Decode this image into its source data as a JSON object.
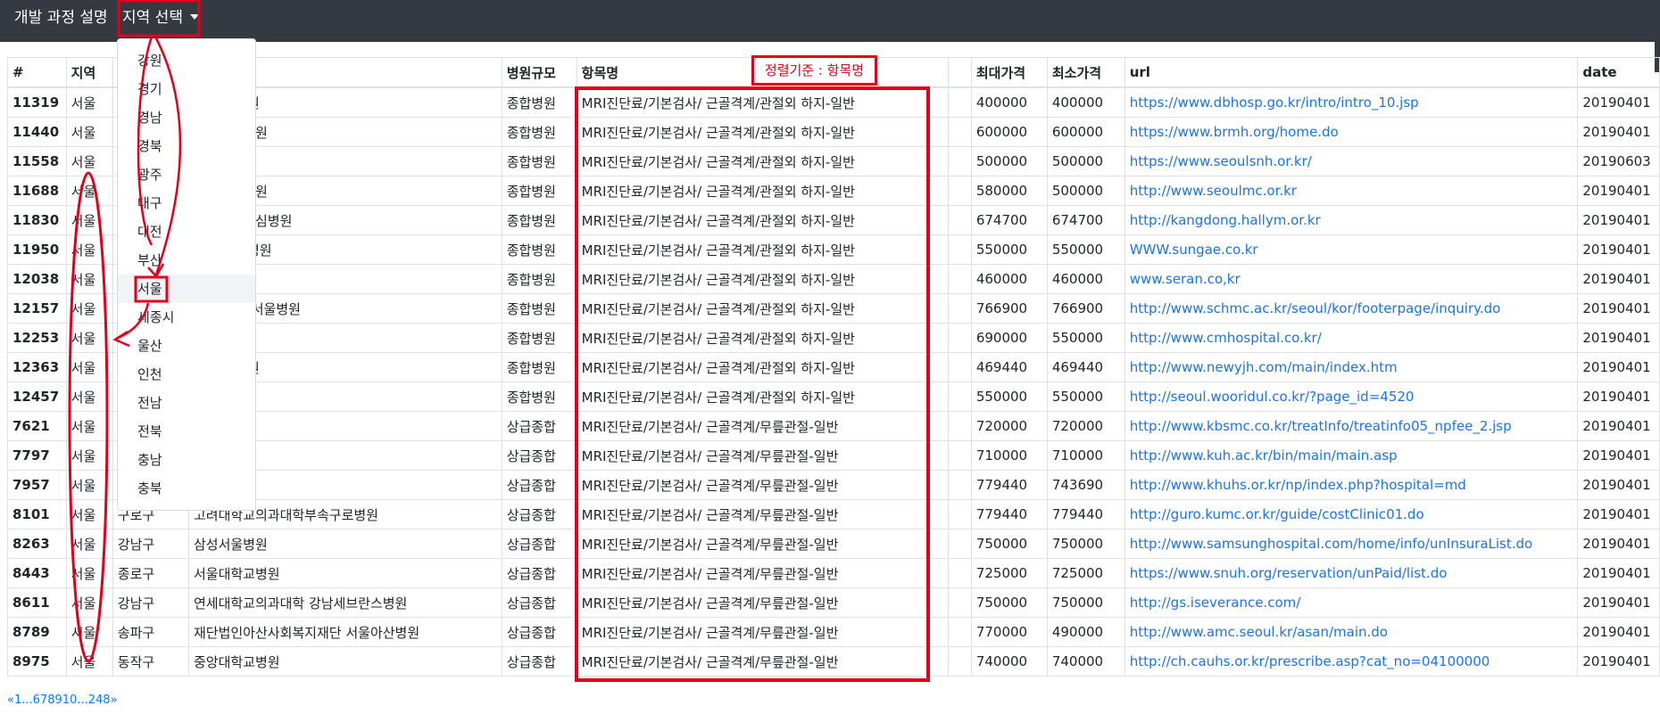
{
  "navbar": {
    "about_label": "개발 과정 설명",
    "region_label": "지역 선택"
  },
  "region_menu": {
    "items": [
      "강원",
      "경기",
      "경남",
      "경북",
      "광주",
      "대구",
      "대전",
      "부산",
      "서울",
      "세종시",
      "울산",
      "인천",
      "전남",
      "전북",
      "충남",
      "충북"
    ],
    "selected": "서울"
  },
  "sort_annotation": "정렬기준 : 항목명",
  "table": {
    "columns": [
      "#",
      "지역",
      "",
      "",
      "병원규모",
      "항목명",
      "",
      "최대가격",
      "최소가격",
      "url",
      "date"
    ],
    "rows": [
      [
        "11319",
        "서울",
        "",
        "시 동부병원",
        "종합병원",
        "MRI진단료/기본검사/ 근골격계/관절외 하지-일반",
        "400000",
        "400000",
        "https://www.dbhosp.go.kr/intro/intro_10.jsp",
        "20190401"
      ],
      [
        "11440",
        "서울",
        "",
        "시보라매병원",
        "종합병원",
        "MRI진단료/기본검사/ 근골격계/관절외 하지-일반",
        "600000",
        "600000",
        "https://www.brmh.org/home.do",
        "20190401"
      ],
      [
        "11558",
        "서울",
        "",
        "시서남병원",
        "종합병원",
        "MRI진단료/기본검사/ 근골격계/관절외 하지-일반",
        "500000",
        "500000",
        "https://www.seoulsnh.or.kr/",
        "20190603"
      ],
      [
        "11688",
        "서울",
        "",
        "시서울의료원",
        "종합병원",
        "MRI진단료/기본검사/ 근골격계/관절외 하지-일반",
        "580000",
        "500000",
        "http://www.seoulmc.or.kr",
        "20190401"
      ],
      [
        "11830",
        "서울",
        "",
        "재단강동성심병원",
        "종합병원",
        "MRI진단료/기본검사/ 근골격계/관절외 하지-일반",
        "674700",
        "674700",
        "http://kangdong.hallym.or.kr",
        "20190401"
      ],
      [
        "11950",
        "서울",
        "",
        "재단 성애병원",
        "종합병원",
        "MRI진단료/기본검사/ 근골격계/관절외 하지-일반",
        "550000",
        "550000",
        "WWW.sungae.co.kr",
        "20190401"
      ],
      [
        "12038",
        "서울",
        "",
        "",
        "종합병원",
        "MRI진단료/기본검사/ 근골격계/관절외 하지-일반",
        "460000",
        "460000",
        "www.seran.co,kr",
        "20190401"
      ],
      [
        "12157",
        "서울",
        "",
        "학교 부속 서울병원",
        "종합병원",
        "MRI진단료/기본검사/ 근골격계/관절외 하지-일반",
        "766900",
        "766900",
        "http://www.schmc.ac.kr/seoul/kor/footerpage/inquiry.do",
        "20190401"
      ],
      [
        "12253",
        "서울",
        "",
        "",
        "종합병원",
        "MRI진단료/기본검사/ 근골격계/관절외 하지-일반",
        "690000",
        "550000",
        "http://www.cmhospital.co.kr/",
        "20190401"
      ],
      [
        "12363",
        "서울",
        "",
        "스 양지병원",
        "종합병원",
        "MRI진단료/기본검사/ 근골격계/관절외 하지-일반",
        "469440",
        "469440",
        "http://www.newyjh.com/main/index.htm",
        "20190401"
      ],
      [
        "12457",
        "서울",
        "",
        "원",
        "종합병원",
        "MRI진단료/기본검사/ 근골격계/관절외 하지-일반",
        "550000",
        "550000",
        "http://seoul.wooridul.co.kr/?page_id=4520",
        "20190401"
      ],
      [
        "7621",
        "서울",
        "",
        "병원",
        "상급종합",
        "MRI진단료/기본검사/ 근골격계/무릎관절-일반",
        "720000",
        "720000",
        "http://www.kbsmc.co.kr/treatInfo/treatinfo05_npfee_2.jsp",
        "20190401"
      ],
      [
        "7797",
        "서울",
        "",
        "교병원",
        "상급종합",
        "MRI진단료/기본검사/ 근골격계/무릎관절-일반",
        "710000",
        "710000",
        "http://www.kuh.ac.kr/bin/main/main.asp",
        "20190401"
      ],
      [
        "7957",
        "서울",
        "",
        "교병원",
        "상급종합",
        "MRI진단료/기본검사/ 근골격계/무릎관절-일반",
        "779440",
        "743690",
        "http://www.khuhs.or.kr/np/index.php?hospital=md",
        "20190401"
      ],
      [
        "8101",
        "서울",
        "구로구",
        "고려대학교의과대학부속구로병원",
        "상급종합",
        "MRI진단료/기본검사/ 근골격계/무릎관절-일반",
        "779440",
        "779440",
        "http://guro.kumc.or.kr/guide/costClinic01.do",
        "20190401"
      ],
      [
        "8263",
        "서울",
        "강남구",
        "삼성서울병원",
        "상급종합",
        "MRI진단료/기본검사/ 근골격계/무릎관절-일반",
        "750000",
        "750000",
        "http://www.samsunghospital.com/home/info/unInsuraList.do",
        "20190401"
      ],
      [
        "8443",
        "서울",
        "종로구",
        "서울대학교병원",
        "상급종합",
        "MRI진단료/기본검사/ 근골격계/무릎관절-일반",
        "725000",
        "725000",
        "https://www.snuh.org/reservation/unPaid/list.do",
        "20190401"
      ],
      [
        "8611",
        "서울",
        "강남구",
        "연세대학교의과대학 강남세브란스병원",
        "상급종합",
        "MRI진단료/기본검사/ 근골격계/무릎관절-일반",
        "750000",
        "750000",
        "http://gs.iseverance.com/",
        "20190401"
      ],
      [
        "8789",
        "서울",
        "송파구",
        "재단법인아산사회복지재단 서울아산병원",
        "상급종합",
        "MRI진단료/기본검사/ 근골격계/무릎관절-일반",
        "770000",
        "490000",
        "http://www.amc.seoul.kr/asan/main.do",
        "20190401"
      ],
      [
        "8975",
        "서울",
        "동작구",
        "중앙대학교병원",
        "상급종합",
        "MRI진단료/기본검사/ 근골격계/무릎관절-일반",
        "740000",
        "740000",
        "http://ch.cauhs.or.kr/prescribe.asp?cat_no=04100000",
        "20190401"
      ]
    ]
  },
  "pagination": {
    "prev": "«",
    "pages": [
      "1",
      "...",
      "6",
      "7",
      "8",
      "9",
      "10",
      "...",
      "248"
    ],
    "next": "»"
  },
  "colors": {
    "navbar": "#343a40",
    "annotation": "#e0001b",
    "link": "#1a73e8"
  }
}
